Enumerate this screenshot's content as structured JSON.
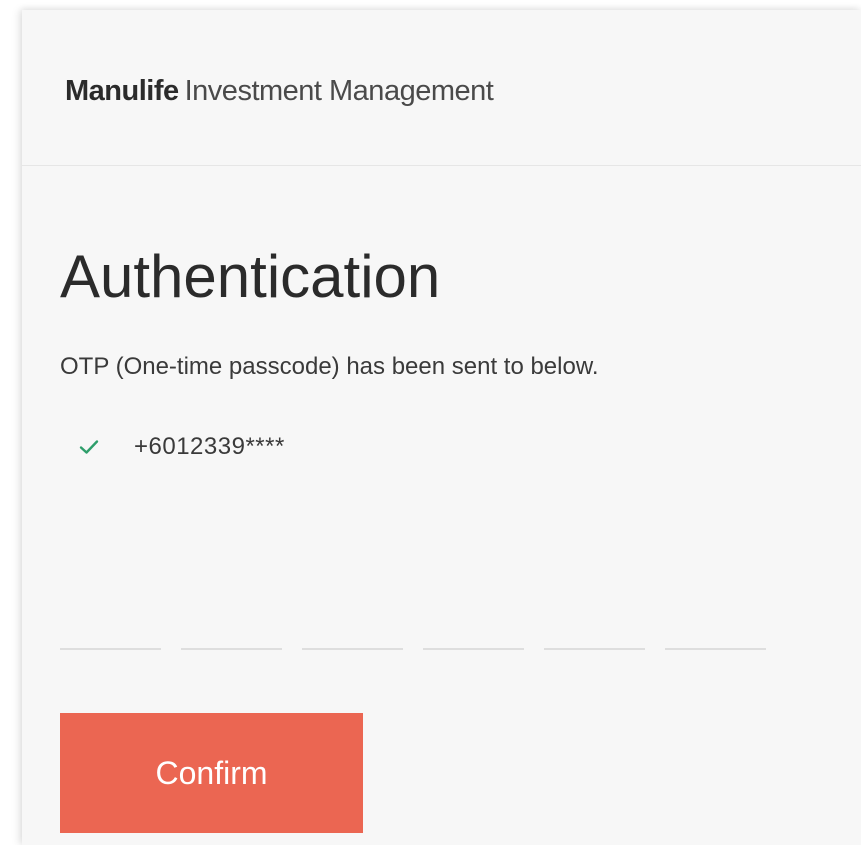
{
  "header": {
    "brand": "Manulife",
    "brand_sub": "Investment Management"
  },
  "main": {
    "title": "Authentication",
    "message": "OTP (One-time passcode) has been sent to below.",
    "recipient": {
      "icon": "check-icon",
      "phone": "+6012339****"
    },
    "otp": {
      "digits": [
        "",
        "",
        "",
        "",
        "",
        ""
      ]
    },
    "confirm_label": "Confirm"
  },
  "colors": {
    "accent": "#eb6652",
    "check": "#2e9e6b",
    "background": "#f7f7f7"
  }
}
